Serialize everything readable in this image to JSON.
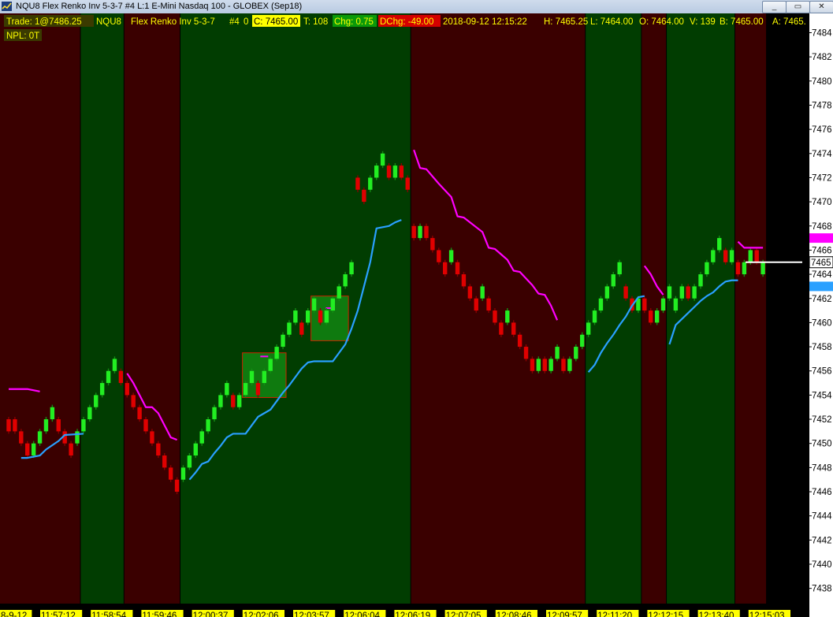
{
  "window": {
    "title": "NQU8  Flex Renko Inv 5-3-7  #4  L:1  E-Mini Nasdaq 100 - GLOBEX (Sep18)",
    "minimize_label": "_",
    "restore_label": "▭",
    "close_label": "✕"
  },
  "infobar": {
    "trade": "Trade: 1@7486.25",
    "symbol": "NQU8",
    "bartype": "Flex Renko Inv 5-3-7",
    "chart_num": "#4",
    "zero": "0",
    "close": "C: 7465.00",
    "ticks": "T: 108",
    "chg": "Chg: 0.75",
    "dchg": "DChg: -49.00",
    "datetime": "2018-09-12 12:15:22",
    "high": "H: 7465.25",
    "low": "L: 7464.00",
    "open": "O: 7464.00",
    "volume": "V: 139",
    "bid": "B: 7465.00",
    "ask": "A: 7465.",
    "npl": "NPL: 0T"
  },
  "colors": {
    "up_bar": "#22ee22",
    "down_bar": "#e00000",
    "upper_band": "#ff00ff",
    "lower_band": "#2aa0ff",
    "bull_bg": "#013d01",
    "bear_bg": "#3a0000",
    "axis_bg": "#ffffff"
  },
  "chart_data": {
    "type": "candlestick",
    "instrument": "NQU8",
    "ylim": [
      7437,
      7487
    ],
    "y_ticks": [
      7438,
      7440,
      7442,
      7444,
      7446,
      7448,
      7450,
      7452,
      7454,
      7456,
      7458,
      7460,
      7462,
      7464,
      7466,
      7468,
      7470,
      7472,
      7474,
      7476,
      7478,
      7480,
      7482,
      7484
    ],
    "last_price": "7465",
    "upper_tag": "7467",
    "lower_tag": "7463",
    "time_labels": [
      "8-9-12",
      "11:57:12",
      "11:58:54",
      "11:59:46",
      "12:00:37",
      "12:02:06",
      "12:03:57",
      "12:06:04",
      "12:06:19",
      "12:07:05",
      "12:08:46",
      "12:09:57",
      "12:11:20",
      "12:12:15",
      "12:13:40",
      "12:15:03"
    ],
    "regimes": [
      {
        "type": "bear",
        "start": 0,
        "end": 11
      },
      {
        "type": "bull",
        "start": 12,
        "end": 18
      },
      {
        "type": "bear",
        "start": 19,
        "end": 27
      },
      {
        "type": "bull",
        "start": 28,
        "end": 64
      },
      {
        "type": "bear",
        "start": 65,
        "end": 92
      },
      {
        "type": "bull",
        "start": 93,
        "end": 101
      },
      {
        "type": "bear",
        "start": 102,
        "end": 105
      },
      {
        "type": "bull",
        "start": 106,
        "end": 116
      },
      {
        "type": "bear",
        "start": 117,
        "end": 121
      }
    ],
    "bars": [
      [
        7452,
        7451,
        7452.2,
        7450.8
      ],
      [
        7452,
        7451,
        7452.2,
        7450.8
      ],
      [
        7451,
        7450,
        7451.2,
        7449.8
      ],
      [
        7450,
        7449,
        7450.2,
        7448.8
      ],
      [
        7449,
        7450,
        7450.2,
        7448.8
      ],
      [
        7450,
        7451,
        7451.2,
        7449.8
      ],
      [
        7451,
        7452,
        7452.2,
        7450.8
      ],
      [
        7452,
        7453,
        7453.2,
        7451.8
      ],
      [
        7452,
        7451,
        7452.2,
        7450.8
      ],
      [
        7451,
        7450,
        7451.2,
        7449.8
      ],
      [
        7450,
        7449,
        7450.2,
        7448.8
      ],
      [
        7450,
        7451,
        7451.2,
        7449.8
      ],
      [
        7451,
        7452,
        7452.2,
        7450.8
      ],
      [
        7452,
        7453,
        7453.2,
        7451.8
      ],
      [
        7453,
        7454,
        7454.2,
        7452.8
      ],
      [
        7454,
        7455,
        7455.2,
        7453.8
      ],
      [
        7455,
        7456,
        7456.2,
        7454.8
      ],
      [
        7456,
        7457,
        7457.2,
        7455.8
      ],
      [
        7456,
        7455,
        7456.2,
        7454.8
      ],
      [
        7455,
        7454,
        7455.2,
        7453.8
      ],
      [
        7454,
        7453,
        7454.2,
        7452.8
      ],
      [
        7453,
        7452,
        7453.2,
        7451.8
      ],
      [
        7452,
        7451,
        7452.2,
        7450.8
      ],
      [
        7451,
        7450,
        7451.2,
        7449.8
      ],
      [
        7450,
        7449,
        7450.2,
        7448.8
      ],
      [
        7449,
        7448,
        7449.2,
        7447.8
      ],
      [
        7448,
        7447,
        7448.2,
        7446.8
      ],
      [
        7447,
        7446,
        7447.2,
        7445.8
      ],
      [
        7447,
        7448,
        7448.2,
        7446.8
      ],
      [
        7448,
        7449,
        7449.2,
        7447.8
      ],
      [
        7449,
        7450,
        7450.2,
        7448.8
      ],
      [
        7450,
        7451,
        7451.2,
        7449.8
      ],
      [
        7451,
        7452,
        7452.2,
        7450.8
      ],
      [
        7452,
        7453,
        7453.2,
        7451.8
      ],
      [
        7453,
        7454,
        7454.2,
        7452.8
      ],
      [
        7454,
        7455,
        7455.2,
        7453.8
      ],
      [
        7454,
        7453,
        7454.2,
        7452.8
      ],
      [
        7453,
        7454,
        7454.2,
        7452.8
      ],
      [
        7454,
        7455,
        7455.2,
        7453.8
      ],
      [
        7455,
        7456,
        7456.2,
        7454.8
      ],
      [
        7455,
        7454,
        7455.2,
        7453.8
      ],
      [
        7455,
        7456,
        7456.2,
        7454.8
      ],
      [
        7456,
        7457,
        7457.2,
        7455.8
      ],
      [
        7457,
        7458,
        7458.2,
        7456.8
      ],
      [
        7458,
        7459,
        7459.2,
        7457.8
      ],
      [
        7459,
        7460,
        7460.2,
        7458.8
      ],
      [
        7460,
        7461,
        7461.2,
        7459.8
      ],
      [
        7460,
        7459,
        7460.2,
        7458.8
      ],
      [
        7460,
        7461,
        7461.2,
        7459.8
      ],
      [
        7461,
        7462,
        7462.2,
        7460.8
      ],
      [
        7461,
        7460,
        7461.2,
        7459.8
      ],
      [
        7460,
        7461,
        7461.2,
        7459.8
      ],
      [
        7461,
        7462,
        7462.2,
        7460.8
      ],
      [
        7462,
        7463,
        7463.2,
        7461.8
      ],
      [
        7463,
        7464,
        7464.2,
        7462.8
      ],
      [
        7464,
        7465,
        7465.2,
        7463.8
      ],
      [
        7472,
        7471,
        7472.2,
        7470.8
      ],
      [
        7471,
        7470,
        7471.2,
        7469.8
      ],
      [
        7471,
        7472,
        7472.2,
        7470.8
      ],
      [
        7472,
        7473,
        7473.2,
        7471.8
      ],
      [
        7473,
        7474,
        7474.2,
        7472.8
      ],
      [
        7473,
        7472,
        7473.2,
        7471.8
      ],
      [
        7472,
        7473,
        7473.2,
        7471.8
      ],
      [
        7473,
        7472,
        7473.2,
        7471.8
      ],
      [
        7472,
        7471,
        7472.2,
        7470.8
      ],
      [
        7468,
        7467,
        7468.2,
        7466.8
      ],
      [
        7467,
        7468,
        7468.2,
        7466.8
      ],
      [
        7468,
        7467,
        7468.2,
        7466.8
      ],
      [
        7467,
        7466,
        7467.2,
        7465.8
      ],
      [
        7466,
        7465,
        7466.2,
        7464.8
      ],
      [
        7465,
        7464,
        7465.2,
        7463.8
      ],
      [
        7465,
        7466,
        7466.2,
        7464.8
      ],
      [
        7465,
        7464,
        7465.2,
        7463.8
      ],
      [
        7464,
        7463,
        7464.2,
        7462.8
      ],
      [
        7463,
        7462,
        7463.2,
        7461.8
      ],
      [
        7462,
        7461,
        7462.2,
        7460.8
      ],
      [
        7462,
        7463,
        7463.2,
        7461.8
      ],
      [
        7462,
        7461,
        7462.2,
        7460.8
      ],
      [
        7461,
        7460,
        7461.2,
        7459.8
      ],
      [
        7460,
        7459,
        7460.2,
        7458.8
      ],
      [
        7460,
        7461,
        7461.2,
        7459.8
      ],
      [
        7460,
        7459,
        7460.2,
        7458.8
      ],
      [
        7459,
        7458,
        7459.2,
        7457.8
      ],
      [
        7458,
        7457,
        7458.2,
        7456.8
      ],
      [
        7457,
        7456,
        7457.2,
        7455.8
      ],
      [
        7456,
        7457,
        7457.2,
        7455.8
      ],
      [
        7457,
        7456,
        7457.2,
        7455.8
      ],
      [
        7456,
        7457,
        7457.2,
        7455.8
      ],
      [
        7457,
        7458,
        7458.2,
        7456.8
      ],
      [
        7457,
        7456,
        7457.2,
        7455.8
      ],
      [
        7456,
        7457,
        7457.2,
        7455.8
      ],
      [
        7457,
        7458,
        7458.2,
        7456.8
      ],
      [
        7458,
        7459,
        7459.2,
        7457.8
      ],
      [
        7459,
        7460,
        7460.2,
        7458.8
      ],
      [
        7460,
        7461,
        7461.2,
        7459.8
      ],
      [
        7461,
        7462,
        7462.2,
        7460.8
      ],
      [
        7462,
        7463,
        7463.2,
        7461.8
      ],
      [
        7463,
        7464,
        7464.2,
        7462.8
      ],
      [
        7464,
        7465,
        7465.2,
        7463.8
      ],
      [
        7463,
        7462,
        7463.2,
        7461.8
      ],
      [
        7462,
        7461,
        7462.2,
        7460.8
      ],
      [
        7461,
        7462,
        7462.2,
        7460.8
      ],
      [
        7462,
        7461,
        7462.2,
        7460.8
      ],
      [
        7461,
        7460,
        7461.2,
        7459.8
      ],
      [
        7460,
        7461,
        7461.2,
        7459.8
      ],
      [
        7461,
        7462,
        7462.2,
        7460.8
      ],
      [
        7462,
        7463,
        7463.2,
        7461.8
      ],
      [
        7461,
        7462,
        7462.2,
        7460.8
      ],
      [
        7462,
        7463,
        7463.2,
        7461.8
      ],
      [
        7463,
        7462,
        7463.2,
        7461.8
      ],
      [
        7462,
        7463,
        7463.2,
        7461.8
      ],
      [
        7463,
        7464,
        7464.2,
        7462.8
      ],
      [
        7464,
        7465,
        7465.2,
        7463.8
      ],
      [
        7465,
        7466,
        7466.2,
        7464.8
      ],
      [
        7466,
        7467,
        7467.2,
        7465.8
      ],
      [
        7466,
        7465,
        7466.2,
        7464.8
      ],
      [
        7465,
        7466,
        7466.2,
        7464.8
      ],
      [
        7465,
        7464,
        7465.2,
        7463.8
      ],
      [
        7464,
        7465,
        7465.2,
        7463.8
      ],
      [
        7465,
        7466,
        7466.2,
        7464.8
      ],
      [
        7466,
        7465,
        7466.2,
        7464.8
      ],
      [
        7464,
        7465,
        7465.2,
        7463.8
      ]
    ],
    "upper_band": [
      [
        0,
        7454.5
      ],
      [
        3,
        7454.5
      ],
      [
        5,
        7454.3
      ],
      [
        12,
        7454.3
      ],
      [
        19,
        7455.8
      ],
      [
        20,
        7455
      ],
      [
        21,
        7454
      ],
      [
        22,
        7453
      ],
      [
        23,
        7453
      ],
      [
        24,
        7452.5
      ],
      [
        25,
        7451.5
      ],
      [
        26,
        7450.5
      ],
      [
        27,
        7450.3
      ],
      [
        65,
        7474.3
      ],
      [
        66,
        7472.8
      ],
      [
        67,
        7472.7
      ],
      [
        69,
        7471.5
      ],
      [
        71,
        7470.4
      ],
      [
        72,
        7468.8
      ],
      [
        73,
        7468.7
      ],
      [
        76,
        7467.5
      ],
      [
        77,
        7466.2
      ],
      [
        78,
        7466.1
      ],
      [
        80,
        7465.2
      ],
      [
        81,
        7464.3
      ],
      [
        82,
        7464.2
      ],
      [
        84,
        7463.1
      ],
      [
        85,
        7462.4
      ],
      [
        86,
        7462.3
      ],
      [
        87,
        7461.4
      ],
      [
        88,
        7460.2
      ],
      [
        92,
        7460.2
      ],
      [
        102,
        7464.7
      ],
      [
        103,
        7464
      ],
      [
        104,
        7463
      ],
      [
        105,
        7462.3
      ],
      [
        117,
        7466.7
      ],
      [
        118,
        7466.2
      ],
      [
        121,
        7466.2
      ]
    ],
    "lower_band": [
      [
        2,
        7448.8
      ],
      [
        3,
        7448.8
      ],
      [
        5,
        7449
      ],
      [
        6,
        7449.5
      ],
      [
        8,
        7450.2
      ],
      [
        9,
        7450.7
      ],
      [
        12,
        7450.8
      ],
      [
        18,
        7450.8
      ],
      [
        29,
        7447
      ],
      [
        30,
        7447.6
      ],
      [
        31,
        7448.3
      ],
      [
        32,
        7448.5
      ],
      [
        33,
        7449.2
      ],
      [
        34,
        7449.8
      ],
      [
        35,
        7450.5
      ],
      [
        36,
        7450.8
      ],
      [
        38,
        7450.8
      ],
      [
        39,
        7451.5
      ],
      [
        40,
        7452.2
      ],
      [
        41,
        7452.5
      ],
      [
        42,
        7452.8
      ],
      [
        43,
        7453.5
      ],
      [
        44,
        7454.2
      ],
      [
        45,
        7454.8
      ],
      [
        46,
        7455.5
      ],
      [
        47,
        7456.2
      ],
      [
        48,
        7456.7
      ],
      [
        49,
        7456.8
      ],
      [
        52,
        7456.8
      ],
      [
        53,
        7457.5
      ],
      [
        54,
        7458.2
      ],
      [
        55,
        7459.5
      ],
      [
        56,
        7461
      ],
      [
        57,
        7463
      ],
      [
        58,
        7465
      ],
      [
        59,
        7467.8
      ],
      [
        61,
        7468
      ],
      [
        62,
        7468.3
      ],
      [
        63,
        7468.5
      ],
      [
        68,
        7468.5
      ],
      [
        93,
        7455.9
      ],
      [
        94,
        7456.5
      ],
      [
        95,
        7457.5
      ],
      [
        96,
        7458.3
      ],
      [
        97,
        7459
      ],
      [
        98,
        7459.8
      ],
      [
        99,
        7460.5
      ],
      [
        100,
        7461.4
      ],
      [
        101,
        7462.1
      ],
      [
        102,
        7462.2
      ],
      [
        106,
        7458.2
      ],
      [
        107,
        7459.8
      ],
      [
        108,
        7460.3
      ],
      [
        110,
        7461.3
      ],
      [
        111,
        7461.8
      ],
      [
        112,
        7462.2
      ],
      [
        113,
        7462.5
      ],
      [
        114,
        7463
      ],
      [
        115,
        7463.4
      ],
      [
        116,
        7463.5
      ],
      [
        117,
        7463.5
      ]
    ],
    "boxes": [
      {
        "start": 38,
        "end": 44,
        "top": 7457.5,
        "bottom": 7453.8,
        "mark": 7457.2
      },
      {
        "start": 49,
        "end": 54,
        "top": 7462.2,
        "bottom": 7458.5,
        "mark": 7461.2
      }
    ]
  }
}
